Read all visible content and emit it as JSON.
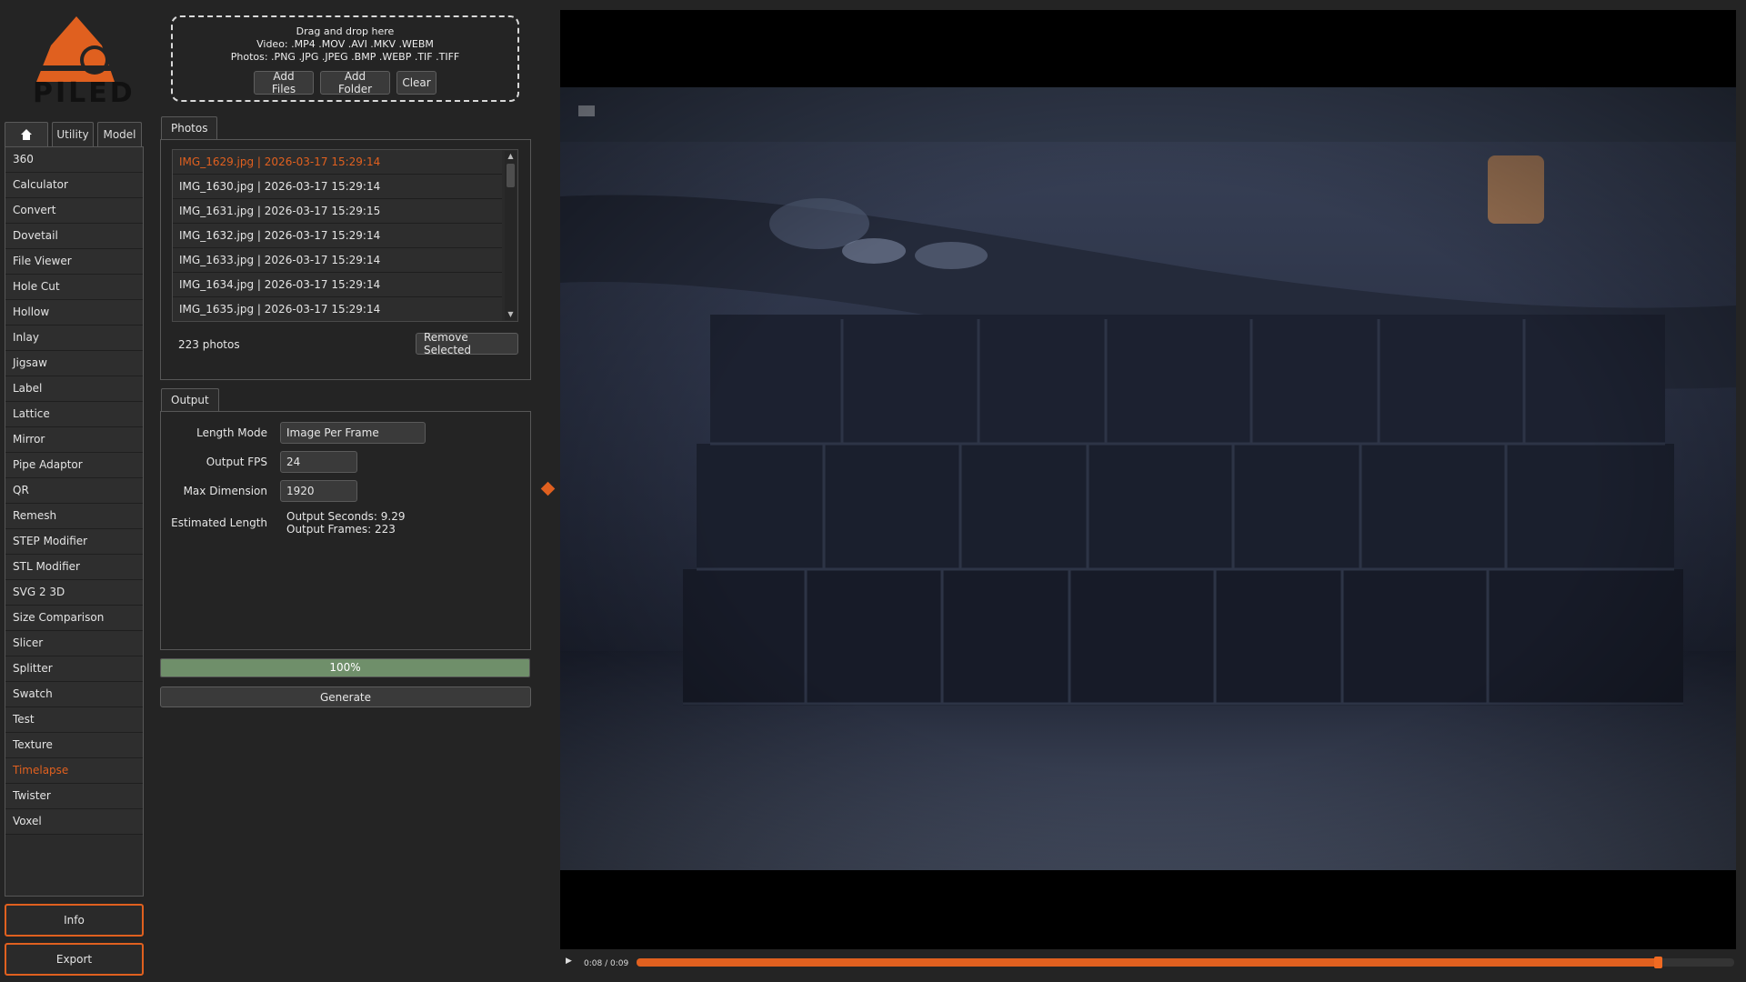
{
  "app": {
    "logo_text": "PILED",
    "accent_color": "#e0601f",
    "success_color": "#6f8f6a"
  },
  "sidebar": {
    "tabs": [
      {
        "icon": "home-icon"
      },
      {
        "label": "Utility"
      },
      {
        "label": "Model"
      }
    ],
    "items": [
      {
        "label": "360"
      },
      {
        "label": "Calculator"
      },
      {
        "label": "Convert"
      },
      {
        "label": "Dovetail"
      },
      {
        "label": "File Viewer"
      },
      {
        "label": "Hole Cut"
      },
      {
        "label": "Hollow"
      },
      {
        "label": "Inlay"
      },
      {
        "label": "Jigsaw"
      },
      {
        "label": "Label"
      },
      {
        "label": "Lattice"
      },
      {
        "label": "Mirror"
      },
      {
        "label": "Pipe Adaptor"
      },
      {
        "label": "QR"
      },
      {
        "label": "Remesh"
      },
      {
        "label": "STEP Modifier"
      },
      {
        "label": "STL Modifier"
      },
      {
        "label": "SVG 2 3D"
      },
      {
        "label": "Size Comparison"
      },
      {
        "label": "Slicer"
      },
      {
        "label": "Splitter"
      },
      {
        "label": "Swatch"
      },
      {
        "label": "Test"
      },
      {
        "label": "Texture"
      },
      {
        "label": "Timelapse",
        "active": true
      },
      {
        "label": "Twister"
      },
      {
        "label": "Voxel"
      }
    ],
    "info_label": "Info",
    "export_label": "Export"
  },
  "dropzone": {
    "title": "Drag and drop here",
    "video_types": "Video: .MP4 .MOV .AVI .MKV .WEBM",
    "photo_types": "Photos: .PNG .JPG .JPEG .BMP .WEBP .TIF .TIFF",
    "add_files_label": "Add Files",
    "add_folder_label": "Add Folder",
    "clear_label": "Clear"
  },
  "photos": {
    "tab_label": "Photos",
    "files": [
      {
        "text": "IMG_1629.jpg | 2026-03-17 15:29:14",
        "selected": true
      },
      {
        "text": "IMG_1630.jpg | 2026-03-17 15:29:14"
      },
      {
        "text": "IMG_1631.jpg | 2026-03-17 15:29:15"
      },
      {
        "text": "IMG_1632.jpg | 2026-03-17 15:29:14"
      },
      {
        "text": "IMG_1633.jpg | 2026-03-17 15:29:14"
      },
      {
        "text": "IMG_1634.jpg | 2026-03-17 15:29:14"
      },
      {
        "text": "IMG_1635.jpg | 2026-03-17 15:29:14"
      }
    ],
    "count_text": "223 photos",
    "remove_selected_label": "Remove Selected"
  },
  "output": {
    "tab_label": "Output",
    "length_mode_label": "Length Mode",
    "length_mode_value": "Image Per Frame",
    "fps_label": "Output FPS",
    "fps_value": "24",
    "max_dim_label": "Max Dimension",
    "max_dim_value": "1920",
    "est_length_label": "Estimated Length",
    "output_seconds": "Output Seconds: 9.29",
    "output_frames": "Output Frames: 223"
  },
  "progress": {
    "value": 1.0,
    "text": "100%"
  },
  "generate_label": "Generate",
  "player": {
    "play_icon": "play-icon",
    "time_text": "0:08 / 0:09",
    "position": 0.93
  }
}
